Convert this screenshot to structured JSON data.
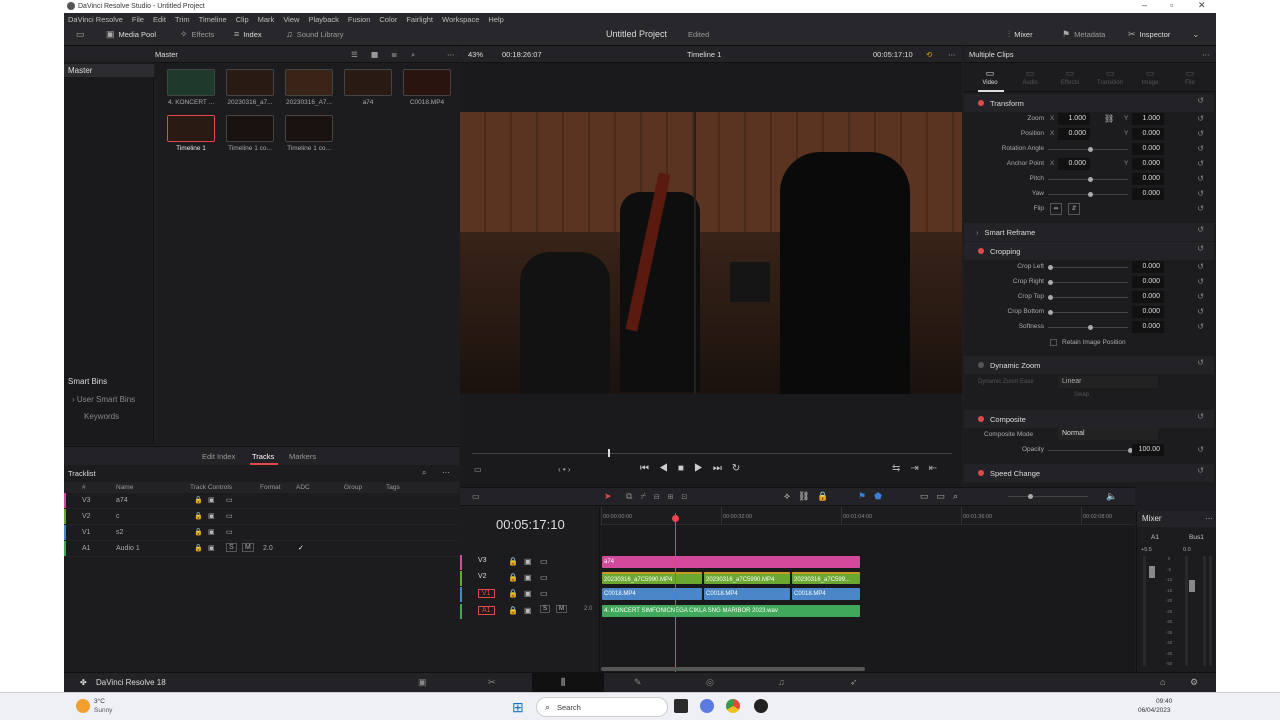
{
  "window": {
    "title": "DaVinci Resolve Studio - Untitled Project"
  },
  "menu": [
    "DaVinci Resolve",
    "File",
    "Edit",
    "Trim",
    "Timeline",
    "Clip",
    "Mark",
    "View",
    "Playback",
    "Fusion",
    "Color",
    "Fairlight",
    "Workspace",
    "Help"
  ],
  "toolbar": {
    "media_pool": "Media Pool",
    "effects": "Effects",
    "index": "Index",
    "sound_library": "Sound Library",
    "project_title": "Untitled Project",
    "project_status": "Edited",
    "mixer": "Mixer",
    "metadata": "Metadata",
    "inspector": "Inspector"
  },
  "media_pool": {
    "bin_title": "Master",
    "sidebar_master": "Master",
    "smart_bins": "Smart Bins",
    "user_smart_bins": "User Smart Bins",
    "keywords": "Keywords",
    "clips": [
      {
        "label": "4. KONCERT ..."
      },
      {
        "label": "20230316_a7..."
      },
      {
        "label": "20230316_A7..."
      },
      {
        "label": "a74"
      },
      {
        "label": "C0018.MP4"
      },
      {
        "label": "Timeline 1"
      },
      {
        "label": "Timeline 1 co..."
      },
      {
        "label": "Timeline 1 co..."
      }
    ]
  },
  "viewer": {
    "zoom": "43%",
    "source_tc": "00:18:26:07",
    "timeline_name": "Timeline 1",
    "tc": "00:05:17:10"
  },
  "index": {
    "tabs": [
      "Edit Index",
      "Tracks",
      "Markers"
    ],
    "active_tab": "Tracks",
    "tracklist": "Tracklist",
    "columns": [
      "#",
      "Name",
      "Track Controls",
      "Format",
      "ADC",
      "Group",
      "Tags"
    ],
    "rows": [
      {
        "num": "V3",
        "name": "a74",
        "format": "",
        "adc": ""
      },
      {
        "num": "V2",
        "name": "c",
        "format": "",
        "adc": ""
      },
      {
        "num": "V1",
        "name": "s2",
        "format": "",
        "adc": ""
      },
      {
        "num": "A1",
        "name": "Audio 1",
        "format": "2.0",
        "adc": "✓"
      }
    ]
  },
  "inspector": {
    "title": "Multiple Clips",
    "tabs": [
      "Video",
      "Audio",
      "Effects",
      "Transition",
      "Image",
      "File"
    ],
    "transform": "Transform",
    "zoom_label": "Zoom",
    "zoom_x": "1.000",
    "zoom_y": "1.000",
    "position_label": "Position",
    "pos_x": "0.000",
    "pos_y": "0.000",
    "rotation_label": "Rotation Angle",
    "rotation": "0.000",
    "anchor_label": "Anchor Point",
    "anchor_x": "0.000",
    "anchor_y": "0.000",
    "pitch_label": "Pitch",
    "pitch": "0.000",
    "yaw_label": "Yaw",
    "yaw": "0.000",
    "flip_label": "Flip",
    "smart_reframe": "Smart Reframe",
    "cropping": "Cropping",
    "crop_left_label": "Crop Left",
    "crop_left": "0.000",
    "crop_right_label": "Crop Right",
    "crop_right": "0.000",
    "crop_top_label": "Crop Top",
    "crop_top": "0.000",
    "crop_bottom_label": "Crop Bottom",
    "crop_bottom": "0.000",
    "softness_label": "Softness",
    "softness": "0.000",
    "retain": "Retain Image Position",
    "dynamic_zoom": "Dynamic Zoom",
    "dz_ease_label": "Dynamic Zoom Ease",
    "dz_ease": "Linear",
    "swap": "Swap",
    "composite": "Composite",
    "comp_mode_label": "Composite Mode",
    "comp_mode": "Normal",
    "opacity_label": "Opacity",
    "opacity": "100.00",
    "speed_change": "Speed Change"
  },
  "timeline": {
    "timecode": "00:05:17:10",
    "ruler": [
      "00:00:00:00",
      "00:00:32:00",
      "00:01:04:00",
      "00:01:36:00",
      "00:02:08:00"
    ],
    "tracks": [
      "V3",
      "V2",
      "V1",
      "A1"
    ],
    "a1_format": "2.0",
    "clips": {
      "v3": "a74",
      "v2a": "20230316_a7C5990.MP4",
      "v2b": "20230316_a7C5990.MP4",
      "v2c": "20230316_a7C599...",
      "v1a": "C0018.MP4",
      "v1b": "C0018.MP4",
      "v1c": "C0018.MP4",
      "a1": "4. KONCERT SIMFONICNEGA CIKLA SNG MARIBOR 2023.wav"
    }
  },
  "mixer": {
    "title": "Mixer",
    "ch_a1": "A1",
    "ch_bus1": "Bus1",
    "a1_level": "+5.5",
    "bus_level": "0.0",
    "scale": [
      "0",
      "-5",
      "-10",
      "-15",
      "-20",
      "-25",
      "-30",
      "-35",
      "-40",
      "-45",
      "-50"
    ]
  },
  "footer": {
    "app": "DaVinci Resolve 18"
  },
  "taskbar": {
    "temp": "3°C",
    "weather": "Sunny",
    "search": "Search",
    "time": "09:40",
    "date": "06/04/2023"
  },
  "colors": {
    "accent": "#e04a4a",
    "v3": "#d44a9a",
    "v2": "#6ba832",
    "v1": "#4a86c8",
    "a1": "#3fa85a"
  }
}
